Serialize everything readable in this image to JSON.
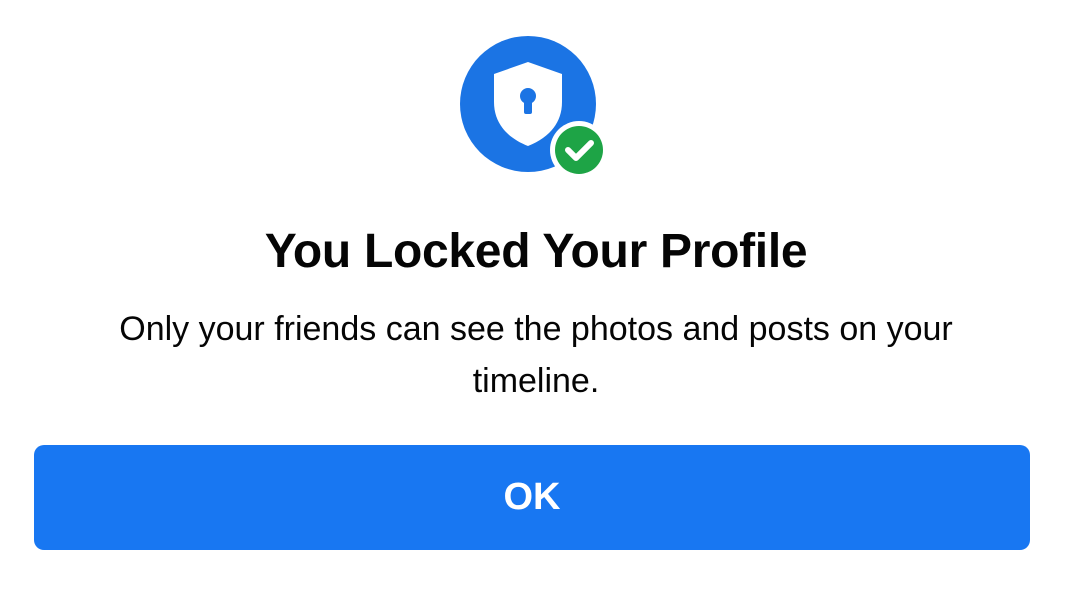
{
  "dialog": {
    "icon": "shield-lock-icon",
    "status_icon": "checkmark-icon",
    "title": "You Locked Your Profile",
    "message": "Only your friends can see the photos and posts on your timeline.",
    "ok_label": "OK"
  },
  "colors": {
    "primary_blue": "#1877f2",
    "badge_blue": "#1b74e4",
    "success_green": "#1ea446",
    "text": "#050505",
    "background": "#ffffff"
  }
}
